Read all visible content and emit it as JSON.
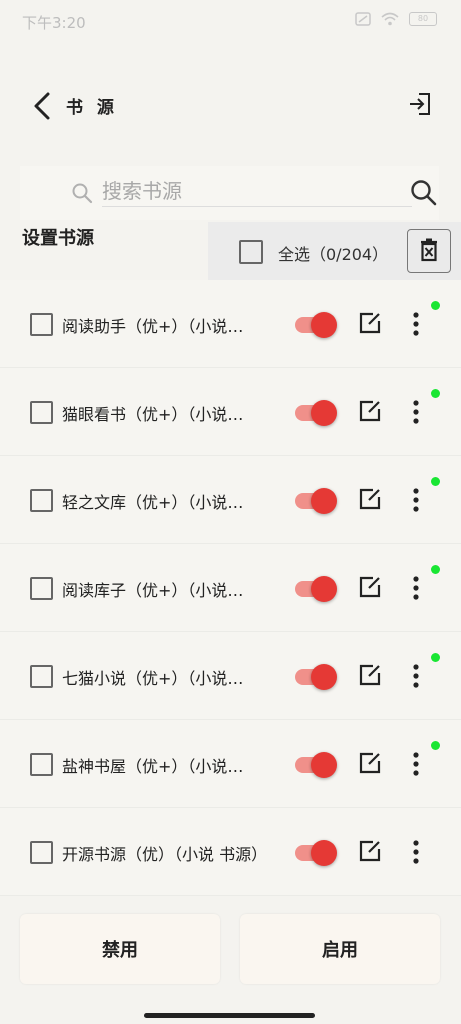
{
  "status_bar": {
    "time": "下午3:20",
    "battery": "80"
  },
  "toolbar": {
    "title": "书 源"
  },
  "search": {
    "placeholder": "搜索书源"
  },
  "section": {
    "label": "设置书源"
  },
  "select_all": {
    "label": "全选（0/204）"
  },
  "sources": [
    {
      "name": "阅读助手（优+）（小说…",
      "enabled": true,
      "status_dot": true
    },
    {
      "name": "猫眼看书（优+）（小说…",
      "enabled": true,
      "status_dot": true
    },
    {
      "name": "轻之文库（优+）（小说…",
      "enabled": true,
      "status_dot": true
    },
    {
      "name": "阅读库子（优+）（小说…",
      "enabled": true,
      "status_dot": true
    },
    {
      "name": "七猫小说（优+）（小说…",
      "enabled": true,
      "status_dot": true
    },
    {
      "name": "盐神书屋（优+）（小说…",
      "enabled": true,
      "status_dot": true
    },
    {
      "name": "开源书源（优）（小说 书源）",
      "enabled": true,
      "status_dot": false
    }
  ],
  "bottom": {
    "disable_label": "禁用",
    "enable_label": "启用"
  },
  "colors": {
    "toggle_on": "#e53935",
    "status_dot": "#19e633"
  }
}
